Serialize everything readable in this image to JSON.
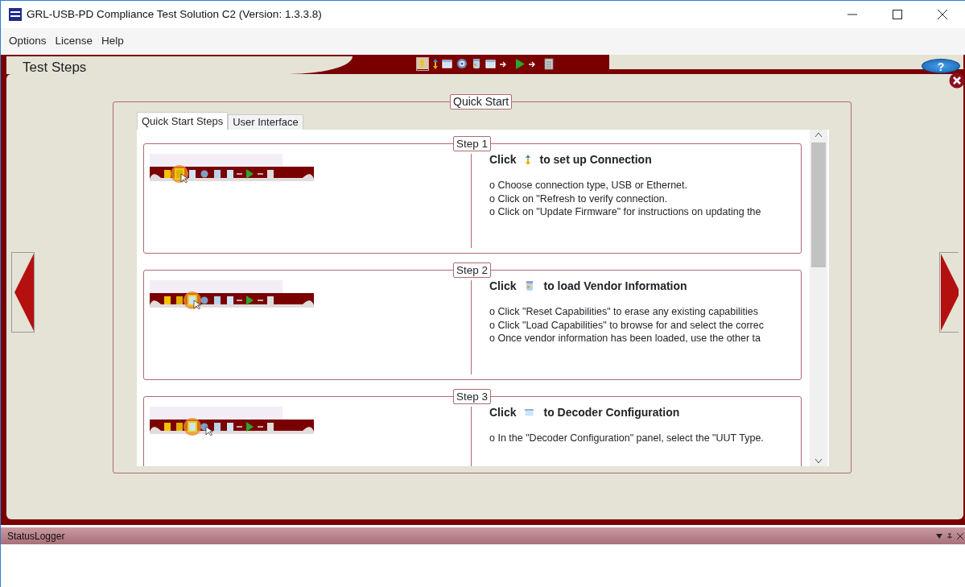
{
  "window": {
    "title": "GRL-USB-PD Compliance Test Solution C2 (Version: 1.3.3.8)"
  },
  "menu": [
    "Options",
    "License",
    "Help"
  ],
  "header": {
    "title": "Test Steps",
    "help_button": "?"
  },
  "quick_start": {
    "title": "Quick Start",
    "tabs": [
      {
        "label": "Quick Start Steps",
        "selected": true
      },
      {
        "label": "User Interface",
        "selected": false
      }
    ],
    "steps": [
      {
        "label": "Step 1",
        "click": "Click",
        "action": "to set up Connection",
        "bullets": [
          "o Choose connection  type, USB or Ethernet.",
          "o Click on \"Refresh to verify connection.",
          "o Click on \"Update Firmware\" for instructions on updating the"
        ]
      },
      {
        "label": "Step 2",
        "click": "Click",
        "action": "to load Vendor Information",
        "bullets": [
          "o Click \"Reset Capabilities\" to erase any existing capabilities",
          "o Click \"Load Capabilities\" to browse for and select the correc",
          "o Once vendor information has been loaded, use the other ta"
        ]
      },
      {
        "label": "Step 3",
        "click": "Click",
        "action": "to Decoder Configuration",
        "bullets": [
          "o In the \"Decoder Configuration\" panel, select the \"UUT Type."
        ]
      }
    ]
  },
  "status_logger": {
    "title": "StatusLogger"
  }
}
